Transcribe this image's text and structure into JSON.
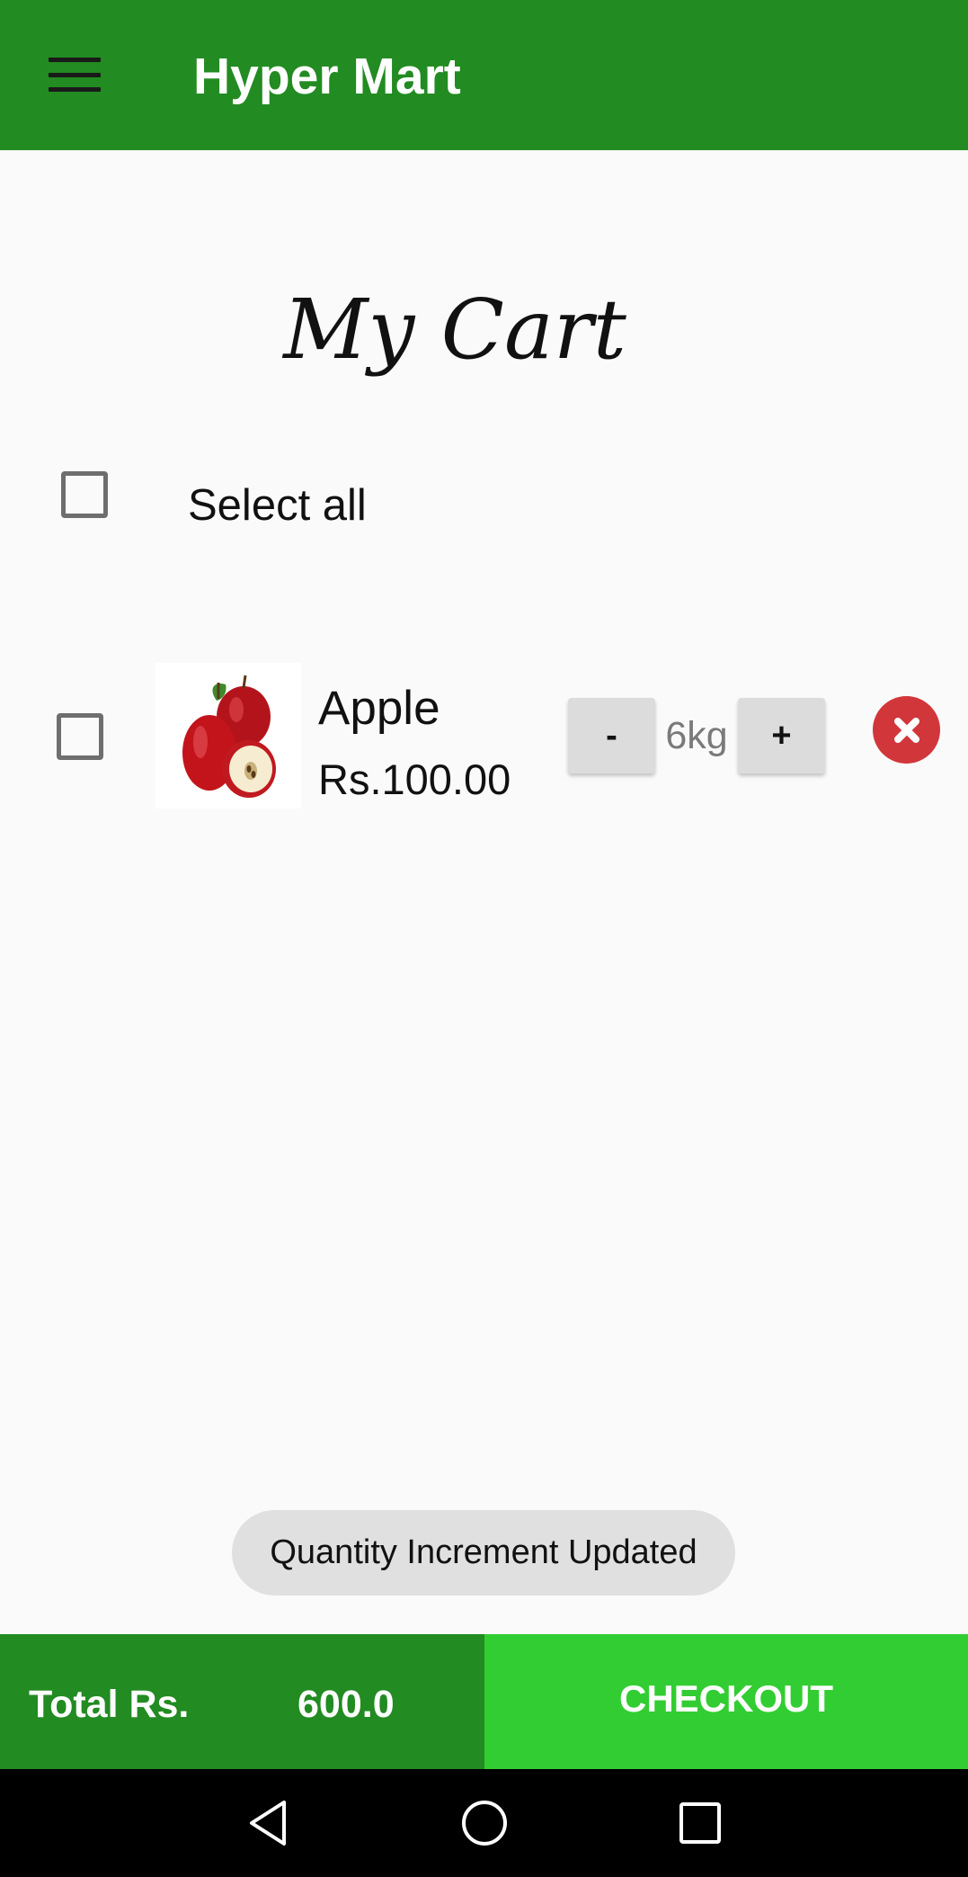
{
  "app": {
    "title": "Hyper Mart",
    "menu_icon": "hamburger-menu-icon",
    "brand_color": "#228b22"
  },
  "page": {
    "title": "My Cart"
  },
  "select_all": {
    "label": "Select all",
    "checked": false
  },
  "cart_items": [
    {
      "name": "Apple",
      "price": "Rs.100.00",
      "quantity": "6kg",
      "checked": false,
      "decrement_label": "-",
      "increment_label": "+",
      "image_icon": "apple-image",
      "remove_icon": "remove-x-icon"
    }
  ],
  "toast": {
    "message": "Quantity Increment Updated"
  },
  "footer": {
    "total_label": "Total Rs.",
    "total_value": "600.0",
    "checkout_label": "CHECKOUT",
    "checkout_color": "#32cd32"
  },
  "nav": {
    "back_icon": "back-triangle-icon",
    "home_icon": "home-circle-icon",
    "recents_icon": "recents-square-icon"
  }
}
